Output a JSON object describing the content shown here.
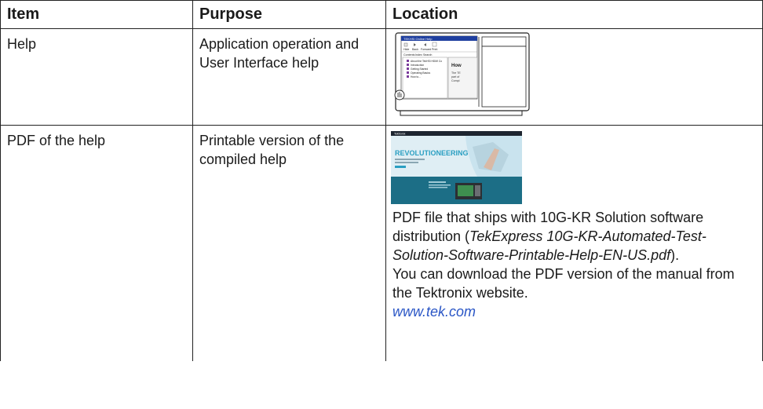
{
  "table": {
    "headers": [
      "Item",
      "Purpose",
      "Location"
    ],
    "rows": [
      {
        "item": "Help",
        "purpose": "Application operation and User Interface help",
        "illustration": {
          "window_title": "TEKHSI Online Help",
          "toolbar": [
            "Hide",
            "Back",
            "Forward",
            "Print"
          ],
          "tabs": [
            "Contents",
            "Index",
            "Search"
          ],
          "tree_items": [
            "About the TekHSI HDMI Co",
            "Introduction",
            "Getting Started",
            "Operating Basics",
            "How to..."
          ],
          "panel_heading": "How",
          "panel_text": [
            "The TE",
            "part of",
            "Compl"
          ]
        }
      },
      {
        "item": "PDF of the help",
        "purpose": "Printable version of the compiled help",
        "thumbnail": {
          "brand": "Tektronix",
          "banner": "REVOLUTIONEERING"
        },
        "location": {
          "line1": "PDF file that ships with 10G-KR Solution software distribution (",
          "filename": "TekExpress 10G-KR-Automated-Test-Solution-Software-Printable-Help-EN-US.pdf",
          "line1_end": ").",
          "line2": "You can download the PDF version of the manual from the Tektronix website.",
          "link": "www.tek.com"
        }
      }
    ]
  },
  "colors": {
    "link": "#2a56c6",
    "illustration_header": "#1f3f9f",
    "thumbnail_sky": "#dfeef4",
    "thumbnail_sea": "#1c6e86"
  }
}
